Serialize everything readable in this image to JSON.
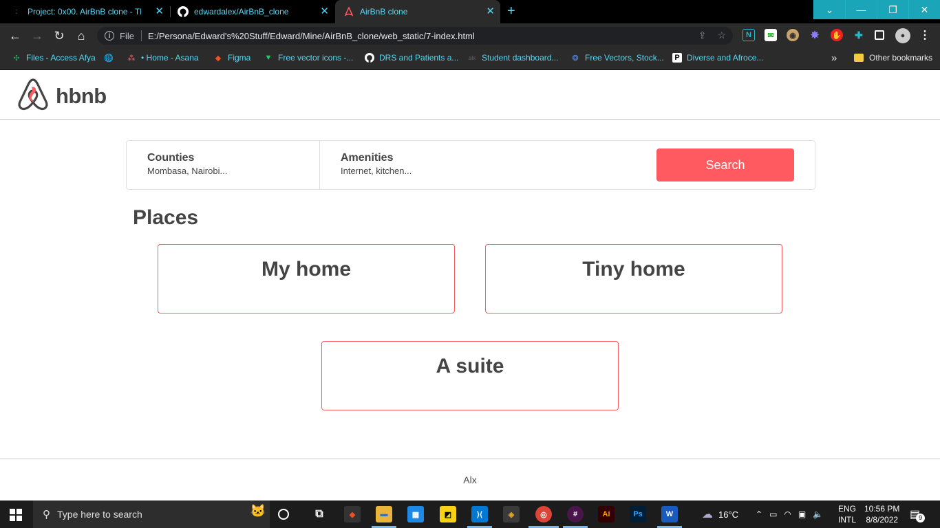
{
  "browser": {
    "tabs": [
      {
        "title": "Project: 0x00. AirBnB clone - The",
        "favicon": "alx-favicon"
      },
      {
        "title": "edwardalex/AirBnB_clone",
        "favicon": "github-icon"
      },
      {
        "title": "AirBnB clone",
        "favicon": "airbnb-favicon",
        "active": true
      }
    ],
    "address": {
      "scheme": "File",
      "url": "E:/Persona/Edward's%20Stuff/Edward/Mine/AirBnB_clone/web_static/7-index.html"
    },
    "bookmarks": [
      {
        "label": "Files - Access Afya",
        "icon": "drive-icon"
      },
      {
        "label": "",
        "icon": "globe-icon"
      },
      {
        "label": "• Home - Asana",
        "icon": "asana-icon"
      },
      {
        "label": "Figma",
        "icon": "figma-icon"
      },
      {
        "label": "Free vector icons -...",
        "icon": "vector-icon"
      },
      {
        "label": "DRS and Patients a...",
        "icon": "github-icon"
      },
      {
        "label": "Student dashboard...",
        "icon": "alx-icon"
      },
      {
        "label": "Free Vectors, Stock...",
        "icon": "freepik-icon"
      },
      {
        "label": "Diverse and Afroce...",
        "icon": "p-icon"
      }
    ],
    "other_bookmarks": "Other bookmarks"
  },
  "site": {
    "logo_text": "hbnb",
    "filters": {
      "counties": {
        "title": "Counties",
        "value": "Mombasa, Nairobi..."
      },
      "amenities": {
        "title": "Amenities",
        "value": "Internet, kitchen..."
      },
      "search_label": "Search"
    },
    "places_title": "Places",
    "places": [
      {
        "name": "My home"
      },
      {
        "name": "Tiny home"
      },
      {
        "name": "A suite"
      }
    ],
    "footer": "Alx"
  },
  "taskbar": {
    "search_placeholder": "Type here to search",
    "weather": "16°C",
    "lang_top": "ENG",
    "lang_bottom": "INTL",
    "time": "10:56 PM",
    "date": "8/8/2022",
    "notifications": "9",
    "slack_badge": "3"
  },
  "colors": {
    "accent": "#ff5a5f",
    "text": "#444444",
    "tab_text": "#5ad8f2",
    "window_controls": "#1aa5b9"
  }
}
